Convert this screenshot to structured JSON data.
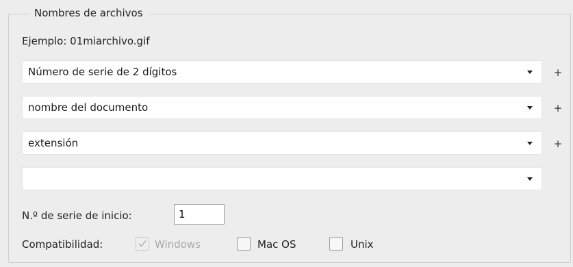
{
  "group": {
    "title": "Nombres de archivos",
    "example": "Ejemplo: 01miarchivo.gif"
  },
  "name_parts": [
    {
      "value": "Número de serie de 2 dígitos",
      "has_add": true
    },
    {
      "value": "nombre del documento",
      "has_add": true
    },
    {
      "value": "extensión",
      "has_add": true
    },
    {
      "value": "",
      "has_add": false
    }
  ],
  "add_symbol": "+",
  "start_serial": {
    "label": "N.º de serie de inicio:",
    "value": "1"
  },
  "compatibility": {
    "label": "Compatibilidad:",
    "options": [
      {
        "label": "Windows",
        "checked": true,
        "disabled": true
      },
      {
        "label": "Mac OS",
        "checked": false,
        "disabled": false
      },
      {
        "label": "Unix",
        "checked": false,
        "disabled": false
      }
    ]
  },
  "icons": {
    "dropdown": "chevron-down-icon",
    "add": "plus-icon",
    "check": "checkmark-icon"
  },
  "colors": {
    "panel_bg": "#ededed",
    "field_bg": "#ffffff",
    "disabled_text": "#a8a8a8"
  }
}
